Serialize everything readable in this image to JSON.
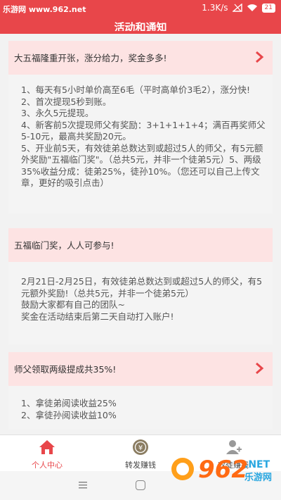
{
  "status_bar": {
    "watermark": "乐游网 www.962.net",
    "speed": "1.3K/s",
    "battery": "21"
  },
  "header": {
    "title": "活动和通知"
  },
  "cards": [
    {
      "title": "大五福隆重开张，涨分给力，奖金多多!",
      "body": "1、每天有5小时单价高至6毛（平时高单价3毛2），涨分快!\n2、首次提现5秒到账。\n3、永久5元提现。\n4、新客前5次提现师父有奖励：3+1+1+1+4；满百再奖师父5-10元，最高共奖励20元。\n5、开业前5天，有效徒弟总数达到或超过5人的师父，有5元额外奖励\"五福临门奖\"。（总共5元，并非一个徒弟5元）5、两级35%收益分成：徒弟25%，徒孙10%。（您还可以自己上传文章，更好的吸引点击）"
    },
    {
      "title": "五福临门奖，人人可参与!",
      "body": "2月21日-2月25日，有效徒弟总数达到或超过5人的师父，有5元额外奖励!（总共5元，并非一个徒弟5元）\n鼓励大家都有自己的团队~\n奖金在活动结束后第二天自动打入账户!"
    },
    {
      "title": "师父领取两级提成共35%!",
      "body": "1、拿徒弟阅读收益25%\n2、拿徒孙阅读收益10%"
    }
  ],
  "bottom_nav": [
    {
      "label": "个人中心",
      "icon": "home-icon"
    },
    {
      "label": "转发赚钱",
      "icon": "money-icon"
    },
    {
      "label": "收徒赚钱",
      "icon": "add-user-icon"
    }
  ],
  "logo": {
    "text": "962",
    "net": ".NET",
    "sub": "乐游网"
  },
  "colors": {
    "accent": "#e8464a",
    "card_head": "#fde3e3"
  }
}
